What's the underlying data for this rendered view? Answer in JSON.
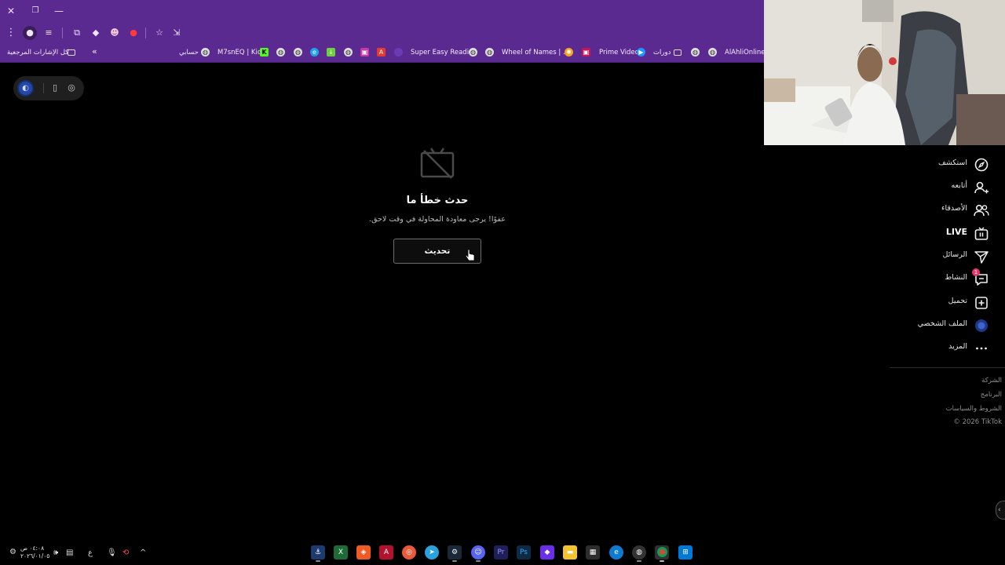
{
  "browser": {
    "bookmarks": {
      "all_bookmarks": "كل الإشارات المرجعية",
      "items": [
        "حسابي",
        "M7snEQ | Kick",
        "Super Easy Reading",
        "Wheel of Names | ...م",
        "Prime Video",
        "دورات",
        "AlAhliOnline"
      ]
    },
    "colors": {
      "chrome": "#5b2a91",
      "page": "#000000"
    }
  },
  "page": {
    "error": {
      "title": "حدث خطأ ما",
      "subtitle": "عفوًا! يرجى معاودة المحاولة في وقت لاحق.",
      "refresh_label": "تحديث"
    }
  },
  "sidebar": {
    "items": [
      {
        "label": "استكشف",
        "icon": "compass-icon"
      },
      {
        "label": "أتابعه",
        "icon": "user-follow-icon"
      },
      {
        "label": "الأصدقاء",
        "icon": "friends-icon"
      },
      {
        "label": "LIVE",
        "icon": "live-tv-icon"
      },
      {
        "label": "الرسائل",
        "icon": "send-icon"
      },
      {
        "label": "النشاط",
        "icon": "activity-icon",
        "badge": "1"
      },
      {
        "label": "تحميل",
        "icon": "upload-plus-icon"
      },
      {
        "label": "الملف الشخصي",
        "icon": "avatar-icon"
      },
      {
        "label": "المزيد",
        "icon": "more-dots-icon"
      }
    ],
    "footer": [
      "الشركة",
      "البرنامج",
      "الشروط والسياسات",
      "© 2026 TikTok"
    ]
  },
  "taskbar": {
    "clock_time": "٠٤:٠٨ ص",
    "clock_date": "٢٠٢٦/٠١/٠٥",
    "lang": "ع"
  }
}
